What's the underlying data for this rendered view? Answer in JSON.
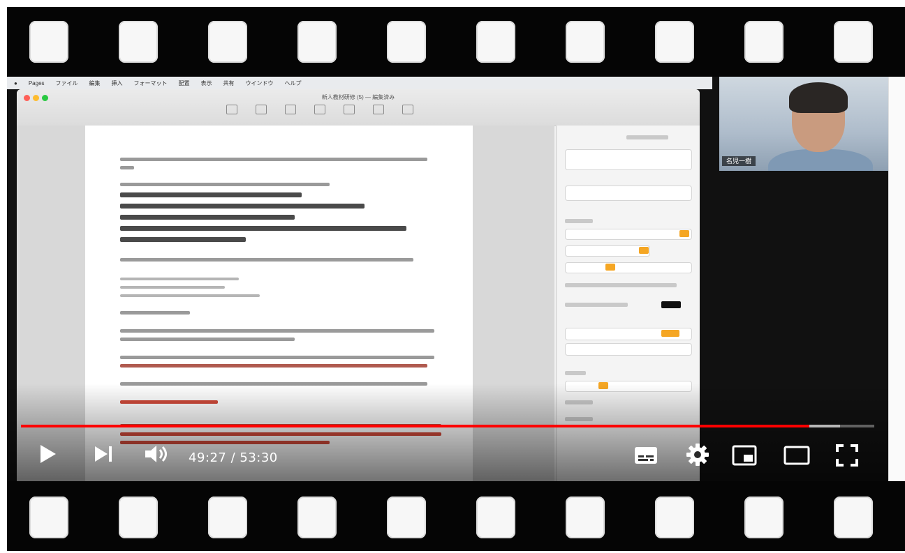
{
  "player": {
    "current_time": "49:27",
    "separator": " / ",
    "duration": "53:30",
    "progress_played": 0.924,
    "progress_buffered": 0.96,
    "accent_color": "#ff0000",
    "icons": [
      "play-icon",
      "next-icon",
      "volume-icon",
      "subtitles-icon",
      "settings-icon",
      "miniplayer-icon",
      "theater-mode-icon",
      "fullscreen-icon"
    ]
  },
  "webcam": {
    "participant_label": "名児一樹"
  },
  "mac": {
    "menu_items": [
      "Pages",
      "ファイル",
      "編集",
      "挿入",
      "フォーマット",
      "配置",
      "表示",
      "共有",
      "ウインドウ",
      "ヘルプ"
    ],
    "doc_title": "新人教材研修 (5) — 編集済み"
  }
}
